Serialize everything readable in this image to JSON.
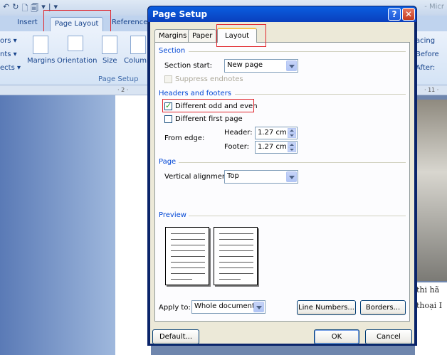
{
  "word": {
    "qat_icons": [
      "↶",
      "↻",
      "🗋",
      "🗐",
      "▾",
      "|",
      "▾"
    ],
    "app_title_fragment": "- Micr",
    "tabs": {
      "insert": "Insert",
      "page_layout": "Page Layout",
      "references": "References"
    },
    "left_group_items": [
      "ors ▾",
      "nts ▾",
      "ects ▾"
    ],
    "buttons": {
      "margins": "Margins",
      "orientation": "Orientation",
      "size": "Size",
      "columns": "Column"
    },
    "group_label": "Page Setup",
    "right_group_items": [
      "acing",
      "Before",
      "After:"
    ],
    "ruler_marks": [
      "· 2 ·",
      "· 11 ·"
    ],
    "doc_text_lines": [
      "thi hã",
      "thoại I"
    ]
  },
  "dialog": {
    "title": "Page Setup",
    "help": "?",
    "close": "✕",
    "tabs": [
      "Margins",
      "Paper",
      "Layout"
    ],
    "active_tab": "Layout",
    "section": {
      "label": "Section",
      "start_label": "Section start:",
      "start_value": "New page",
      "suppress_label": "Suppress endnotes",
      "suppress_checked": false,
      "suppress_enabled": false
    },
    "headers_footers": {
      "label": "Headers and footers",
      "odd_even_label": "Different odd and even",
      "odd_even_checked": true,
      "first_page_label": "Different first page",
      "first_page_checked": false,
      "from_edge_label": "From edge:",
      "header_label": "Header:",
      "header_value": "1.27 cm",
      "footer_label": "Footer:",
      "footer_value": "1.27 cm"
    },
    "page": {
      "label": "Page",
      "valign_label": "Vertical alignment:",
      "valign_value": "Top"
    },
    "preview": {
      "label": "Preview",
      "apply_label": "Apply to:",
      "apply_value": "Whole document",
      "line_numbers": "Line Numbers...",
      "borders": "Borders..."
    },
    "footer_buttons": {
      "default": "Default...",
      "ok": "OK",
      "cancel": "Cancel"
    }
  },
  "colors": {
    "annotation_red": "#e0242b",
    "title_blue": "#0a3fbd",
    "section_blue": "#0046d5"
  }
}
